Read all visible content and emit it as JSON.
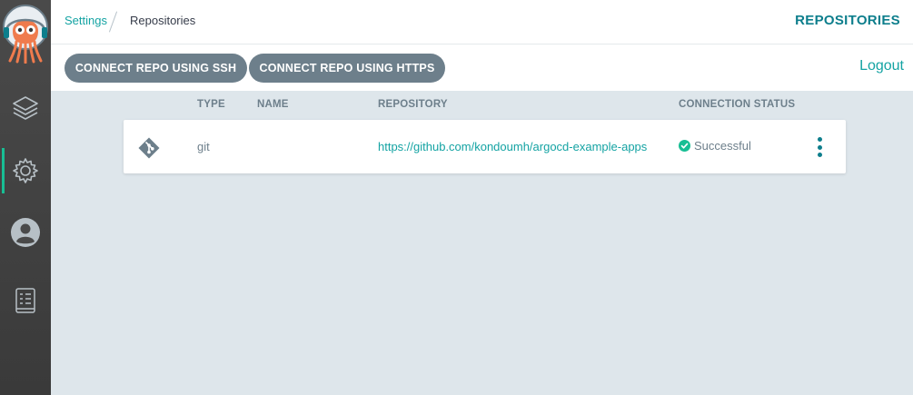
{
  "sidebar": {
    "logo_name": "argo-logo",
    "items": [
      {
        "icon": "layers-icon",
        "active": false
      },
      {
        "icon": "gear-icon",
        "active": true
      },
      {
        "icon": "user-icon",
        "active": false
      },
      {
        "icon": "docs-icon",
        "active": false
      }
    ]
  },
  "breadcrumb": {
    "parent": "Settings",
    "current": "Repositories"
  },
  "header": {
    "title": "REPOSITORIES"
  },
  "toolbar": {
    "ssh_label": "CONNECT REPO USING SSH",
    "https_label": "CONNECT REPO USING HTTPS",
    "logout_label": "Logout"
  },
  "table": {
    "columns": {
      "type": "TYPE",
      "name": "NAME",
      "repository": "REPOSITORY",
      "status": "CONNECTION STATUS"
    },
    "rows": [
      {
        "type": "git",
        "name": "",
        "repository": "https://github.com/kondoumh/argocd-example-apps",
        "status": "Successful"
      }
    ]
  },
  "colors": {
    "accent": "#14a3a3",
    "button": "#6d7f8b",
    "success": "#18be94",
    "sidebar": "#434343",
    "background": "#dee6eb"
  }
}
